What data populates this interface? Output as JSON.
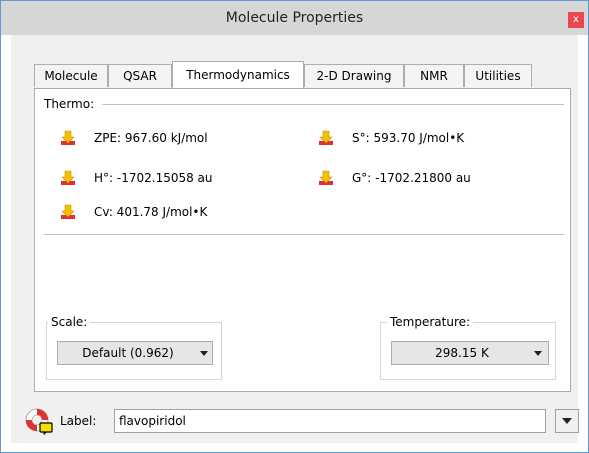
{
  "window": {
    "title": "Molecule Properties",
    "close_label": "x"
  },
  "tabs": [
    {
      "label": "Molecule"
    },
    {
      "label": "QSAR"
    },
    {
      "label": "Thermodynamics"
    },
    {
      "label": "2-D Drawing"
    },
    {
      "label": "NMR"
    },
    {
      "label": "Utilities"
    }
  ],
  "active_tab": "Thermodynamics",
  "thermo": {
    "section_label": "Thermo:",
    "icon": "download-arrow-icon",
    "properties": [
      {
        "text": "ZPE: 967.60 kJ/mol"
      },
      {
        "text": "S°: 593.70 J/mol•K"
      },
      {
        "text": "H°: -1702.15058 au"
      },
      {
        "text": "G°: -1702.21800 au"
      },
      {
        "text": "Cv: 401.78 J/mol•K"
      }
    ]
  },
  "scale": {
    "label": "Scale:",
    "value": "Default (0.962)"
  },
  "temperature": {
    "label": "Temperature:",
    "value": "298.15 K"
  },
  "footer": {
    "label": "Label:",
    "value": "flavopiridol",
    "icon": "lifebuoy-icon"
  },
  "colors": {
    "window_border": "#5b9bd5",
    "close": "#e5484d",
    "icon_yellow": "#f6c000",
    "icon_red": "#e03030"
  }
}
